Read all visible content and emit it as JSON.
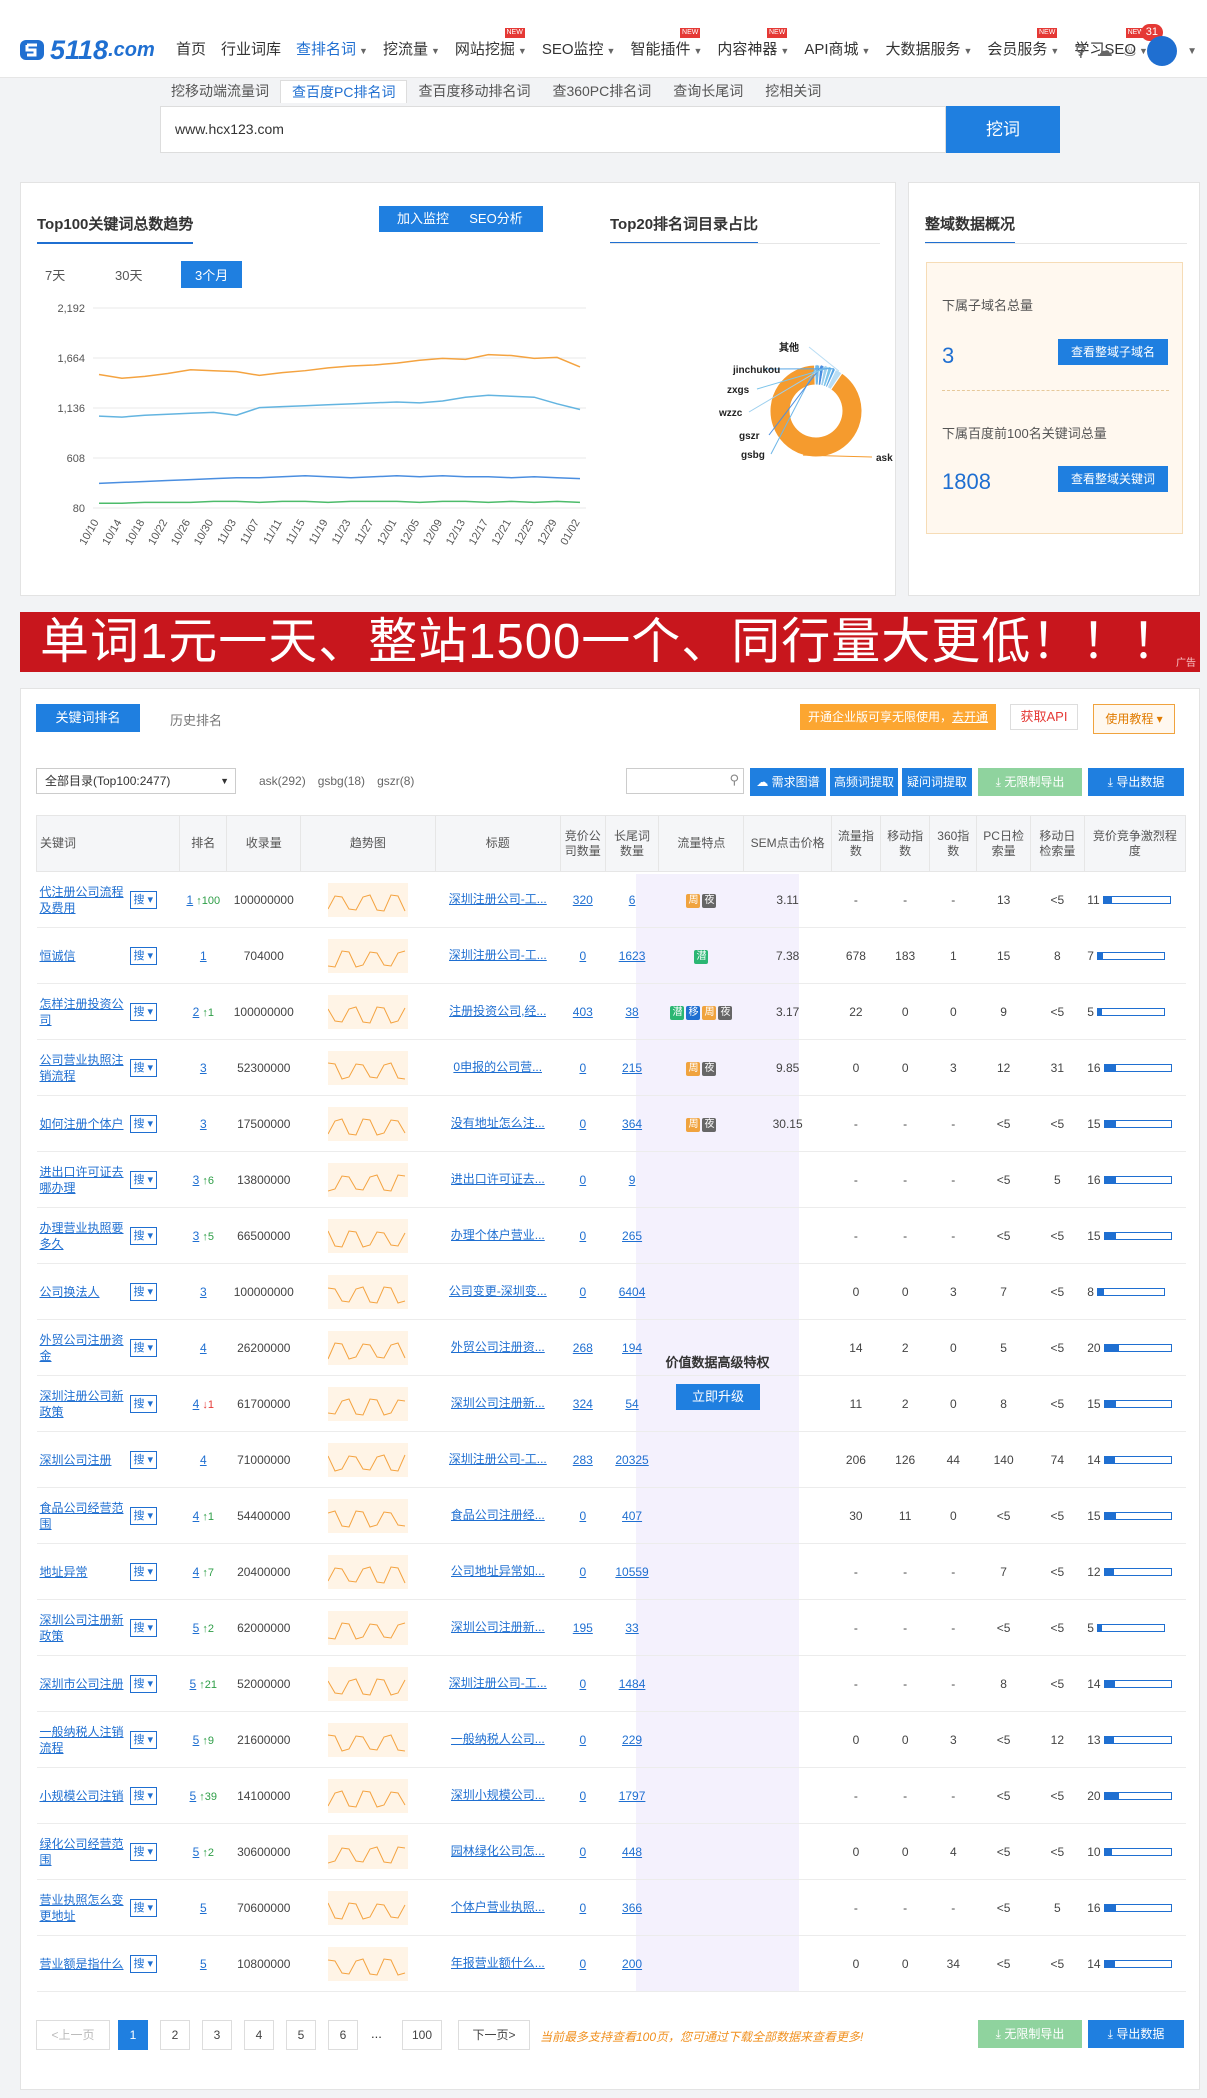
{
  "brand": {
    "name": "5118",
    "domain": ".com"
  },
  "nav": {
    "items": [
      {
        "label": "首页",
        "caret": false,
        "new": false,
        "active": false
      },
      {
        "label": "行业词库",
        "caret": false,
        "new": false,
        "active": false
      },
      {
        "label": "查排名词",
        "caret": true,
        "new": false,
        "active": true
      },
      {
        "label": "挖流量",
        "caret": true,
        "new": false,
        "active": false
      },
      {
        "label": "网站挖掘",
        "caret": true,
        "new": true,
        "active": false
      },
      {
        "label": "SEO监控",
        "caret": true,
        "new": false,
        "active": false
      },
      {
        "label": "智能插件",
        "caret": true,
        "new": true,
        "active": false
      },
      {
        "label": "内容神器",
        "caret": true,
        "new": true,
        "active": false
      },
      {
        "label": "API商城",
        "caret": true,
        "new": false,
        "active": false
      },
      {
        "label": "大数据服务",
        "caret": true,
        "new": false,
        "active": false
      },
      {
        "label": "会员服务",
        "caret": true,
        "new": true,
        "active": false
      },
      {
        "label": "学习SEO",
        "caret": true,
        "new": true,
        "active": false
      }
    ],
    "new_label": "NEW",
    "notification_count": "31"
  },
  "subtabs": [
    "挖移动端流量词",
    "查百度PC排名词",
    "查百度移动排名词",
    "查360PC排名词",
    "查询长尾词",
    "挖相关词"
  ],
  "active_subtab": 1,
  "search": {
    "value": "www.hcx123.com",
    "button": "挖词"
  },
  "trend_panel": {
    "title": "Top100关键词总数趋势",
    "btn_monitor": "加入监控",
    "btn_seo": "SEO分析",
    "ranges": [
      "7天",
      "30天",
      "3个月"
    ],
    "active_range": 2
  },
  "pie_panel": {
    "title": "Top20排名词目录占比"
  },
  "overview": {
    "title": "整域数据概况",
    "sub_label": "下属子域名总量",
    "sub_value": "3",
    "sub_btn": "查看整域子域名",
    "kw_label": "下属百度前100名关键词总量",
    "kw_value": "1808",
    "kw_btn": "查看整域关键词"
  },
  "banner": {
    "text": "单词1元一天、整站1500一个、同行量大更低！！！",
    "ad": "广告"
  },
  "list": {
    "tab_rank": "关键词排名",
    "tab_history": "历史排名",
    "promo": "开通企业版可享无限使用，",
    "promo_link": "去开通",
    "api_btn": "获取API",
    "tutorial_btn": "使用教程",
    "filter": "全部目录(Top100:2477)",
    "dir_tags": [
      "ask(292)",
      "gsbg(18)",
      "gszr(8)"
    ],
    "tools": [
      "需求图谱",
      "高频词提取",
      "疑问词提取",
      "无限制导出",
      "导出数据"
    ],
    "vip_text": "价值数据高级特权",
    "vip_btn": "立即升级",
    "headers": [
      "关键词",
      "排名",
      "收录量",
      "趋势图",
      "标题",
      "竞价公司数量",
      "长尾词数量",
      "流量特点",
      "SEM点击价格",
      "流量指数",
      "移动指数",
      "360指数",
      "PC日检索量",
      "移动日检索量",
      "竞价竞争激烈程度"
    ],
    "sou": "搜",
    "rows": [
      {
        "kw": "代注册公司流程及费用",
        "rank": "1",
        "chg": "100",
        "dir": "up",
        "inc": "100000000",
        "title": "深圳注册公司-工...",
        "bid": "320",
        "lt": "6",
        "tags": [
          "周",
          "夜"
        ],
        "sem": "3.11",
        "fl": "-",
        "mo": "-",
        "s360": "-",
        "pc": "13",
        "mob": "<5",
        "cmp": "11",
        "pct": 0.12
      },
      {
        "kw": "恒诚信",
        "rank": "1",
        "chg": "",
        "dir": "",
        "inc": "704000",
        "title": "深圳注册公司-工...",
        "bid": "0",
        "lt": "1623",
        "tags": [
          "潜"
        ],
        "sem": "7.38",
        "fl": "678",
        "mo": "183",
        "s360": "1",
        "pc": "15",
        "mob": "8",
        "cmp": "7",
        "pct": 0.08
      },
      {
        "kw": "怎样注册投资公司",
        "rank": "2",
        "chg": "1",
        "dir": "up",
        "inc": "100000000",
        "title": "注册投资公司,经...",
        "bid": "403",
        "lt": "38",
        "tags": [
          "潜",
          "移",
          "周",
          "夜"
        ],
        "sem": "3.17",
        "fl": "22",
        "mo": "0",
        "s360": "0",
        "pc": "9",
        "mob": "<5",
        "cmp": "5",
        "pct": 0.06
      },
      {
        "kw": "公司营业执照注销流程",
        "rank": "3",
        "chg": "",
        "dir": "",
        "inc": "52300000",
        "title": "0申报的公司营...",
        "bid": "0",
        "lt": "215",
        "tags": [
          "周",
          "夜"
        ],
        "sem": "9.85",
        "fl": "0",
        "mo": "0",
        "s360": "3",
        "pc": "12",
        "mob": "31",
        "cmp": "16",
        "pct": 0.18
      },
      {
        "kw": "如何注册个体户",
        "rank": "3",
        "chg": "",
        "dir": "",
        "inc": "17500000",
        "title": "没有地址怎么注...",
        "bid": "0",
        "lt": "364",
        "tags": [
          "周",
          "夜"
        ],
        "sem": "30.15",
        "fl": "-",
        "mo": "-",
        "s360": "-",
        "pc": "<5",
        "mob": "<5",
        "cmp": "15",
        "pct": 0.17
      },
      {
        "kw": "进出口许可证去哪办理",
        "rank": "3",
        "chg": "6",
        "dir": "up",
        "inc": "13800000",
        "title": "进出口许可证去...",
        "bid": "0",
        "lt": "9",
        "tags": [],
        "sem": "",
        "fl": "-",
        "mo": "-",
        "s360": "-",
        "pc": "<5",
        "mob": "5",
        "cmp": "16",
        "pct": 0.18
      },
      {
        "kw": "办理营业执照要多久",
        "rank": "3",
        "chg": "5",
        "dir": "up",
        "inc": "66500000",
        "title": "办理个体户营业...",
        "bid": "0",
        "lt": "265",
        "tags": [],
        "sem": "",
        "fl": "-",
        "mo": "-",
        "s360": "-",
        "pc": "<5",
        "mob": "<5",
        "cmp": "15",
        "pct": 0.17
      },
      {
        "kw": "公司换法人",
        "rank": "3",
        "chg": "",
        "dir": "",
        "inc": "100000000",
        "title": "公司变更-深圳变...",
        "bid": "0",
        "lt": "6404",
        "tags": [],
        "sem": "",
        "fl": "0",
        "mo": "0",
        "s360": "3",
        "pc": "7",
        "mob": "<5",
        "cmp": "8",
        "pct": 0.09
      },
      {
        "kw": "外贸公司注册资金",
        "rank": "4",
        "chg": "",
        "dir": "",
        "inc": "26200000",
        "title": "外贸公司注册资...",
        "bid": "268",
        "lt": "194",
        "tags": [],
        "sem": "",
        "fl": "14",
        "mo": "2",
        "s360": "0",
        "pc": "5",
        "mob": "<5",
        "cmp": "20",
        "pct": 0.22
      },
      {
        "kw": "深圳注册公司新政策",
        "rank": "4",
        "chg": "1",
        "dir": "down",
        "inc": "61700000",
        "title": "深圳公司注册新...",
        "bid": "324",
        "lt": "54",
        "tags": [],
        "sem": "",
        "fl": "11",
        "mo": "2",
        "s360": "0",
        "pc": "8",
        "mob": "<5",
        "cmp": "15",
        "pct": 0.17
      },
      {
        "kw": "深圳公司注册",
        "rank": "4",
        "chg": "",
        "dir": "",
        "inc": "71000000",
        "title": "深圳注册公司-工...",
        "bid": "283",
        "lt": "20325",
        "tags": [],
        "sem": "",
        "fl": "206",
        "mo": "126",
        "s360": "44",
        "pc": "140",
        "mob": "74",
        "cmp": "14",
        "pct": 0.16
      },
      {
        "kw": "食品公司经营范围",
        "rank": "4",
        "chg": "1",
        "dir": "up",
        "inc": "54400000",
        "title": "食品公司注册经...",
        "bid": "0",
        "lt": "407",
        "tags": [],
        "sem": "",
        "fl": "30",
        "mo": "11",
        "s360": "0",
        "pc": "<5",
        "mob": "<5",
        "cmp": "15",
        "pct": 0.17
      },
      {
        "kw": "地址异常",
        "rank": "4",
        "chg": "7",
        "dir": "up",
        "inc": "20400000",
        "title": "公司地址异常如...",
        "bid": "0",
        "lt": "10559",
        "tags": [],
        "sem": "",
        "fl": "-",
        "mo": "-",
        "s360": "-",
        "pc": "7",
        "mob": "<5",
        "cmp": "12",
        "pct": 0.14
      },
      {
        "kw": "深圳公司注册新政策",
        "rank": "5",
        "chg": "2",
        "dir": "up",
        "inc": "62000000",
        "title": "深圳公司注册新...",
        "bid": "195",
        "lt": "33",
        "tags": [],
        "sem": "",
        "fl": "-",
        "mo": "-",
        "s360": "-",
        "pc": "<5",
        "mob": "<5",
        "cmp": "5",
        "pct": 0.06
      },
      {
        "kw": "深圳市公司注册",
        "rank": "5",
        "chg": "21",
        "dir": "up",
        "inc": "52000000",
        "title": "深圳注册公司-工...",
        "bid": "0",
        "lt": "1484",
        "tags": [],
        "sem": "",
        "fl": "-",
        "mo": "-",
        "s360": "-",
        "pc": "8",
        "mob": "<5",
        "cmp": "14",
        "pct": 0.16
      },
      {
        "kw": "一般纳税人注销流程",
        "rank": "5",
        "chg": "9",
        "dir": "up",
        "inc": "21600000",
        "title": "一般纳税人公司...",
        "bid": "0",
        "lt": "229",
        "tags": [],
        "sem": "",
        "fl": "0",
        "mo": "0",
        "s360": "3",
        "pc": "<5",
        "mob": "12",
        "cmp": "13",
        "pct": 0.15
      },
      {
        "kw": "小规模公司注销",
        "rank": "5",
        "chg": "39",
        "dir": "up",
        "inc": "14100000",
        "title": "深圳小规模公司...",
        "bid": "0",
        "lt": "1797",
        "tags": [],
        "sem": "",
        "fl": "-",
        "mo": "-",
        "s360": "-",
        "pc": "<5",
        "mob": "<5",
        "cmp": "20",
        "pct": 0.22
      },
      {
        "kw": "绿化公司经营范围",
        "rank": "5",
        "chg": "2",
        "dir": "up",
        "inc": "30600000",
        "title": "园林绿化公司怎...",
        "bid": "0",
        "lt": "448",
        "tags": [],
        "sem": "",
        "fl": "0",
        "mo": "0",
        "s360": "4",
        "pc": "<5",
        "mob": "<5",
        "cmp": "10",
        "pct": 0.12
      },
      {
        "kw": "营业执照怎么变更地址",
        "rank": "5",
        "chg": "",
        "dir": "",
        "inc": "70600000",
        "title": "个体户营业执照...",
        "bid": "0",
        "lt": "366",
        "tags": [],
        "sem": "",
        "fl": "-",
        "mo": "-",
        "s360": "-",
        "pc": "<5",
        "mob": "5",
        "cmp": "16",
        "pct": 0.18
      },
      {
        "kw": "营业额是指什么",
        "rank": "5",
        "chg": "",
        "dir": "",
        "inc": "10800000",
        "title": "年报营业额什么...",
        "bid": "0",
        "lt": "200",
        "tags": [],
        "sem": "",
        "fl": "0",
        "mo": "0",
        "s360": "34",
        "pc": "<5",
        "mob": "<5",
        "cmp": "14",
        "pct": 0.16
      }
    ]
  },
  "pager": {
    "prev": "<上一页",
    "pages": [
      "1",
      "2",
      "3",
      "4",
      "5",
      "6"
    ],
    "ellipsis": "...",
    "last": "100",
    "next": "下一页>",
    "note": "当前最多支持查看100页，您可通过下载全部数据来查看更多!",
    "export_unlimited": "无限制导出",
    "export": "导出数据"
  },
  "chart_data": [
    {
      "type": "line",
      "title": "Top100关键词总数趋势",
      "ylim": [
        80,
        2192
      ],
      "yticks": [
        "2,192",
        "1,664",
        "1,136",
        "608",
        "80"
      ],
      "x": [
        "10/10",
        "10/14",
        "10/18",
        "10/22",
        "10/26",
        "10/30",
        "11/03",
        "11/07",
        "11/11",
        "11/15",
        "11/19",
        "11/23",
        "11/27",
        "12/01",
        "12/05",
        "12/09",
        "12/13",
        "12/17",
        "12/21",
        "12/25",
        "12/29",
        "01/02"
      ],
      "series": [
        {
          "color": "#f4a340",
          "values": [
            1490,
            1450,
            1470,
            1500,
            1540,
            1530,
            1520,
            1480,
            1510,
            1530,
            1560,
            1580,
            1590,
            1610,
            1640,
            1660,
            1650,
            1700,
            1690,
            1660,
            1670,
            1570
          ]
        },
        {
          "color": "#63b4e0",
          "values": [
            1050,
            1040,
            1060,
            1070,
            1080,
            1090,
            1060,
            1140,
            1150,
            1160,
            1170,
            1180,
            1190,
            1200,
            1190,
            1210,
            1250,
            1270,
            1260,
            1250,
            1180,
            1120
          ]
        },
        {
          "color": "#4a8ee0",
          "values": [
            340,
            350,
            360,
            370,
            380,
            390,
            400,
            400,
            410,
            420,
            410,
            400,
            410,
            420,
            410,
            420,
            410,
            410,
            400,
            410,
            400,
            390
          ]
        },
        {
          "color": "#4cbb6a",
          "values": [
            130,
            130,
            140,
            140,
            140,
            150,
            150,
            140,
            150,
            150,
            140,
            150,
            150,
            150,
            140,
            150,
            150,
            140,
            150,
            140,
            150,
            140
          ]
        }
      ]
    },
    {
      "type": "pie",
      "title": "Top20排名词目录占比",
      "categories": [
        "ask",
        "gsbg",
        "gszr",
        "wzzc",
        "zxgs",
        "jinchukou",
        "其他"
      ],
      "values": [
        90,
        1.8,
        1.5,
        1.5,
        1.5,
        1.2,
        2.5
      ],
      "colors": [
        "#f59b2e",
        "#6fb7e8",
        "#4a8ee0",
        "#9ccfee",
        "#7cc4ea",
        "#58a6e6",
        "#b9ddf4"
      ]
    }
  ]
}
